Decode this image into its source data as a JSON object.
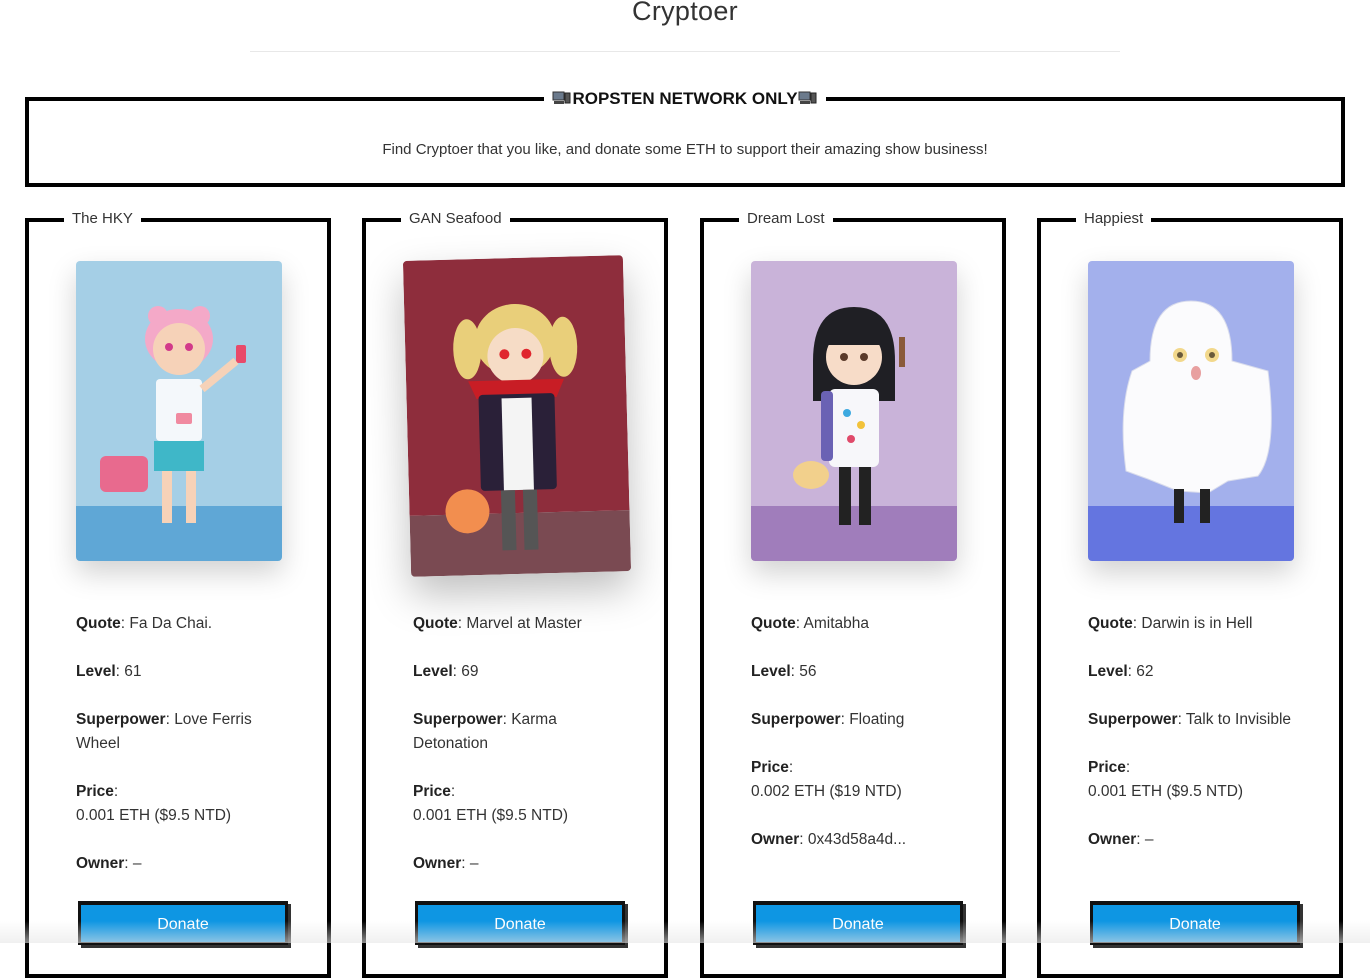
{
  "header": {
    "title": "Cryptoer"
  },
  "notice": {
    "legend": "ROPSTEN NETWORK ONLY",
    "left_icon": "computer-icon",
    "right_icon": "computer-icon",
    "text": "Find Cryptoer that you like, and donate some ETH to support their amazing show business!"
  },
  "labels": {
    "quote": "Quote",
    "level": "Level",
    "superpower": "Superpower",
    "price": "Price",
    "owner": "Owner",
    "donate": "Donate"
  },
  "cards": [
    {
      "name": "The HKY",
      "quote": ": Fa Da Chai.",
      "level": ": 61",
      "superpower": ": Love Ferris Wheel",
      "price_label_suffix": ":",
      "price": "0.001 ETH ($9.5 NTD)",
      "owner": ": –",
      "bg_top": "#a5cfe6",
      "bg_bottom": "#5fa7d6"
    },
    {
      "name": "GAN Seafood",
      "quote": ": Marvel at Master",
      "level": ": 69",
      "superpower": ": Karma Detonation",
      "price_label_suffix": ":",
      "price": "0.001 ETH ($9.5 NTD)",
      "owner": ": –",
      "bg_top": "#8e2d3c",
      "bg_bottom": "#7a4a52"
    },
    {
      "name": "Dream Lost",
      "quote": ": Amitabha",
      "level": ": 56",
      "superpower": ": Floating",
      "price_label_suffix": ":",
      "price": "0.002 ETH ($19 NTD)",
      "owner": ": 0x43d58a4d...",
      "bg_top": "#c9b3d9",
      "bg_bottom": "#a07dbb"
    },
    {
      "name": "Happiest",
      "quote": ": Darwin is in Hell",
      "level": ": 62",
      "superpower": ": Talk to Invisible",
      "price_label_suffix": ":",
      "price": "0.001 ETH ($9.5 NTD)",
      "owner": ": –",
      "bg_top": "#a3b0ec",
      "bg_bottom": "#6475e0"
    }
  ]
}
